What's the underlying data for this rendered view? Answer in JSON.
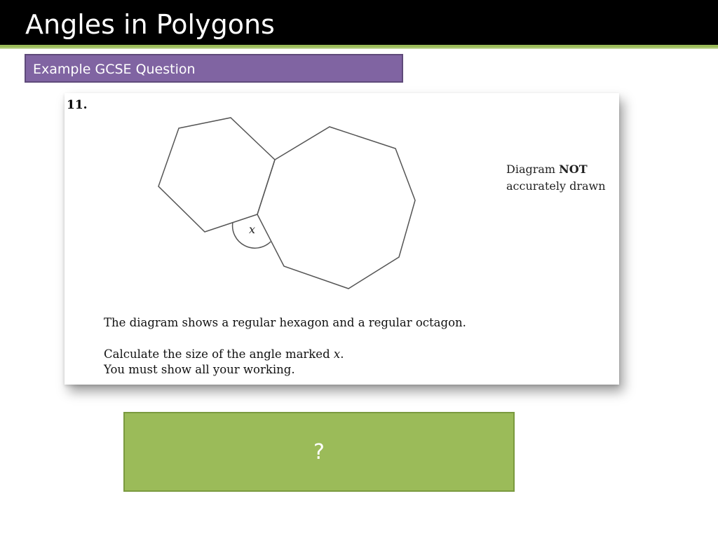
{
  "slide": {
    "title": "Angles in Polygons",
    "subtitle": "Example GCSE Question",
    "accent_color": "#9bbb59",
    "subtitle_color": "#8064a2"
  },
  "question": {
    "number": "11.",
    "diagram_label": "x",
    "note_line1_prefix": "Diagram ",
    "note_line1_bold": "NOT",
    "note_line2": "accurately drawn",
    "text_line1": "The diagram shows a regular hexagon and a regular octagon.",
    "text_line2_prefix": "Calculate the size of the angle marked ",
    "text_line2_var": "x",
    "text_line2_suffix": ".",
    "text_line3": "You must show all your working."
  },
  "answer": {
    "label": "?"
  }
}
